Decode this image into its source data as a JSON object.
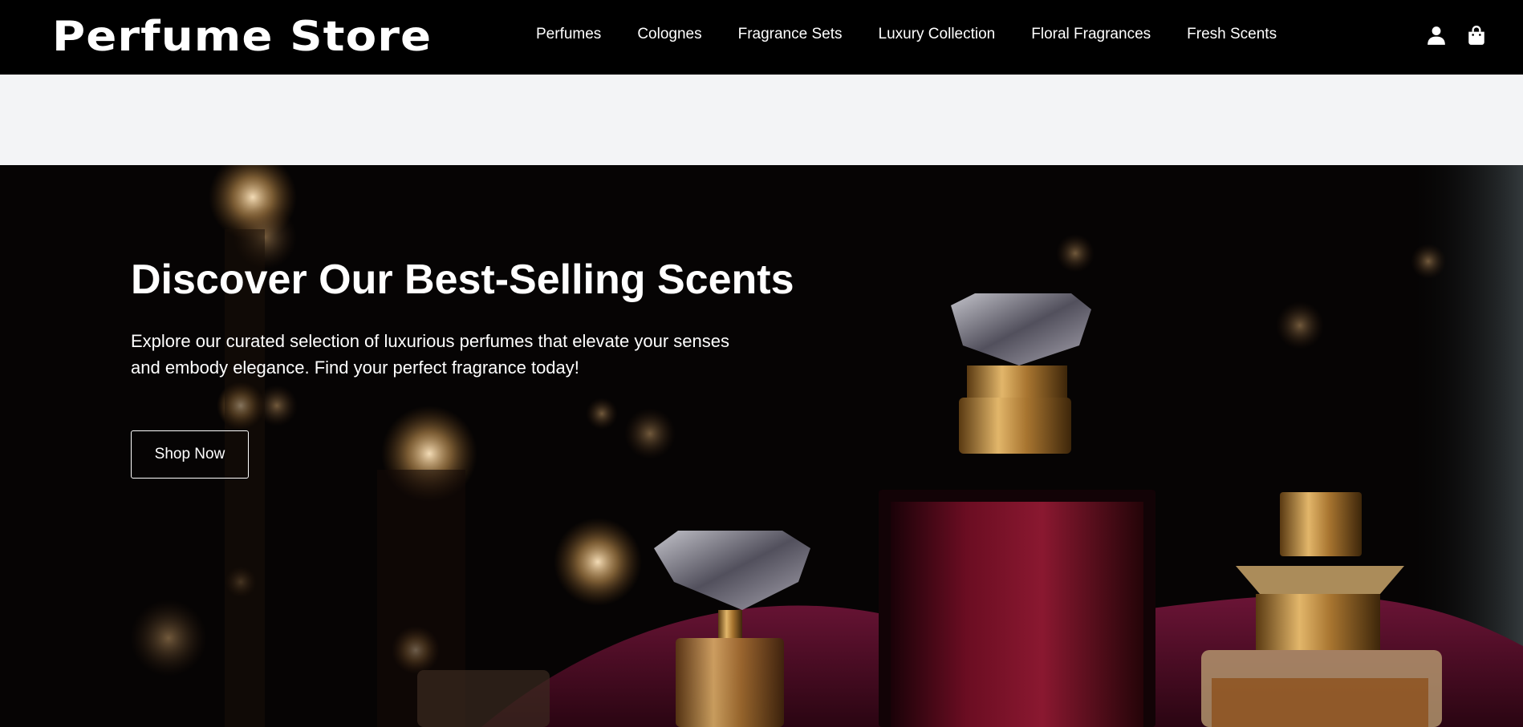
{
  "header": {
    "logo": "Perfume Store",
    "nav": [
      "Perfumes",
      "Colognes",
      "Fragrance Sets",
      "Luxury Collection",
      "Floral Fragrances",
      "Fresh Scents"
    ],
    "icons": [
      "user-icon",
      "shopping-bag-icon"
    ]
  },
  "hero": {
    "title": "Discover Our Best-Selling Scents",
    "subtitle": "Explore our curated selection of luxurious perfumes that elevate your senses and embody elegance. Find your perfect fragrance today!",
    "cta_label": "Shop Now",
    "image": "perfume-bottles-photo"
  },
  "colors": {
    "header_bg": "#000000",
    "strip_bg": "#f3f4f6",
    "text": "#ffffff",
    "velvet": "#5a1030",
    "gold": "#c9953e"
  }
}
